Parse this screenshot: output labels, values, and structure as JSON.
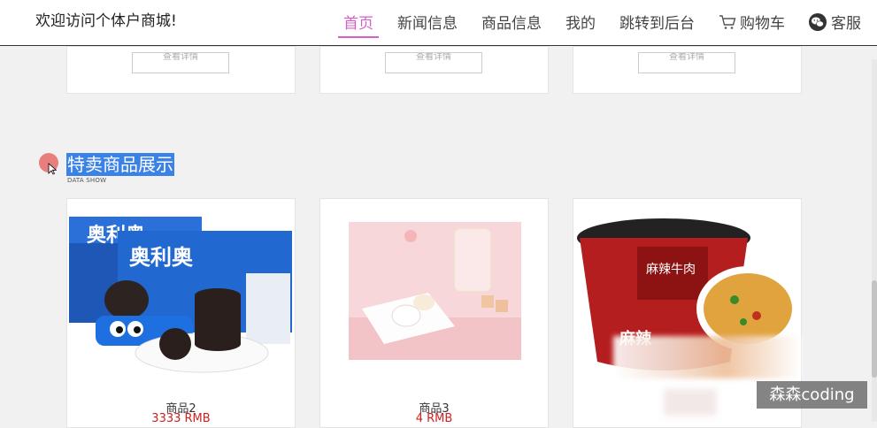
{
  "header": {
    "welcome": "欢迎访问个体户商城!",
    "nav": [
      "首页",
      "新闻信息",
      "商品信息",
      "我的",
      "跳转到后台",
      "购物车",
      "客服"
    ]
  },
  "top_cards": {
    "detail_label": "查看详情"
  },
  "section": {
    "title": "特卖商品展示",
    "subtitle": "DATA SHOW"
  },
  "products": [
    {
      "name": "商品2",
      "price": "3333 RMB",
      "image": "oreo-cookies"
    },
    {
      "name": "商品3",
      "price": "4 RMB",
      "image": "white-candy"
    },
    {
      "name": "",
      "price": "",
      "image": "spicy-noodle-cup"
    }
  ],
  "watermark": "森森coding",
  "colors": {
    "accent": "#d45fc8",
    "price": "#d02020",
    "highlight": "#3b82e6"
  }
}
